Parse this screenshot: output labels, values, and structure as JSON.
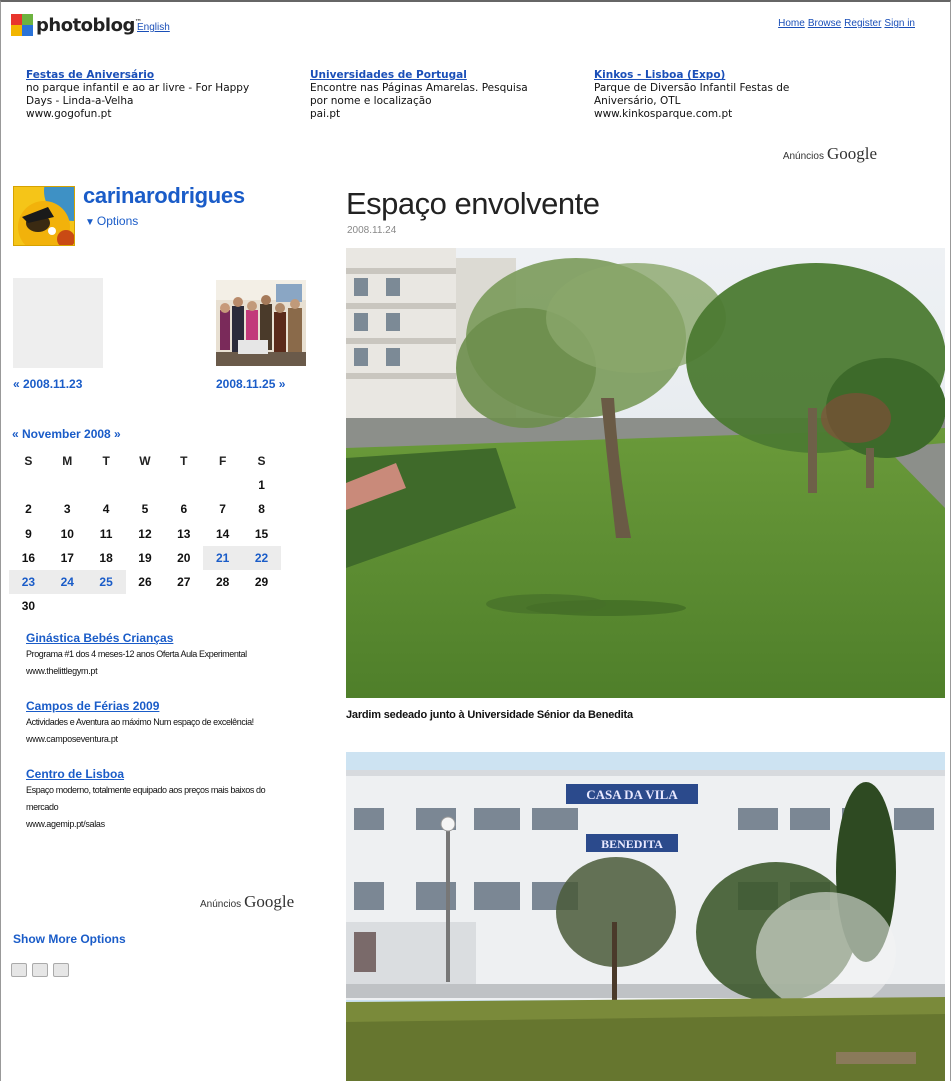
{
  "header": {
    "logo_text": "photoblog",
    "logo_tm": "™",
    "language": "English",
    "nav": [
      "Home",
      "Browse",
      "Register",
      "Sign in"
    ]
  },
  "top_ads": [
    {
      "title": "Festas de Aniversário",
      "text": "no parque infantil e ao ar livre - For Happy Days - Linda-a-Velha",
      "url": "www.gogofun.pt"
    },
    {
      "title": "Universidades de Portugal",
      "text": "Encontre nas Páginas Amarelas. Pesquisa por nome e localização",
      "url": "pai.pt"
    },
    {
      "title": "Kinkos - Lisboa (Expo)",
      "text": "Parque de Diversão Infantil Festas de Aniversário, OTL",
      "url": "www.kinkosparque.com.pt"
    }
  ],
  "ads_by": {
    "label": "Anúncios",
    "brand": "Google"
  },
  "profile": {
    "username": "carinarodrigues",
    "options_label": "Options",
    "options_icon": "triangle-down-icon"
  },
  "navigation": {
    "prev_label": "« 2008.11.23",
    "next_label": "2008.11.25 »"
  },
  "calendar": {
    "title": "« November 2008 »",
    "weekdays": [
      "S",
      "M",
      "T",
      "W",
      "T",
      "F",
      "S"
    ],
    "weeks": [
      [
        "",
        "",
        "",
        "",
        "",
        "",
        "1"
      ],
      [
        "2",
        "3",
        "4",
        "5",
        "6",
        "7",
        "8"
      ],
      [
        "9",
        "10",
        "11",
        "12",
        "13",
        "14",
        "15"
      ],
      [
        "16",
        "17",
        "18",
        "19",
        "20",
        "21",
        "22"
      ],
      [
        "23",
        "24",
        "25",
        "26",
        "27",
        "28",
        "29"
      ],
      [
        "30",
        "",
        "",
        "",
        "",
        "",
        ""
      ]
    ],
    "linked_days": [
      "21",
      "22",
      "23",
      "24",
      "25"
    ]
  },
  "side_ads": [
    {
      "title": "Ginástica Bebés Crianças",
      "text": "Programa #1 dos 4 meses-12 anos Oferta Aula Experimental",
      "url": "www.thelittlegym.pt"
    },
    {
      "title": "Campos de Férias 2009",
      "text": "Actividades e Aventura ao máximo Num espaço de excelência!",
      "url": "www.camposeventura.pt"
    },
    {
      "title": "Centro de Lisboa",
      "text": "Espaço moderno, totalmente equipado aos preços mais baixos do mercado",
      "url": "www.agemip.pt/salas"
    }
  ],
  "sidebar_footer": {
    "show_more": "Show More Options",
    "icons": [
      "rss-icon",
      "print-icon",
      "share-icon"
    ]
  },
  "post": {
    "title": "Espaço envolvente",
    "date": "2008.11.24",
    "caption": "Jardim sedeado junto à Universidade Sénior da Benedita",
    "photo2_sign_top": "CASA DA VILA",
    "photo2_sign_bottom": "BENEDITA"
  }
}
